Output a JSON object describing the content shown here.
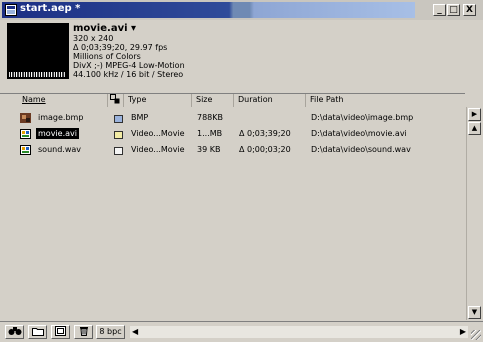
{
  "window": {
    "title": "start.aep *",
    "controls": {
      "minimize": "_",
      "maximize": "□",
      "close": "X"
    }
  },
  "preview": {
    "name": "movie.avi",
    "dropdown": "▾",
    "lines": [
      "320 x 240",
      "Δ 0;03;39;20, 29.97 fps",
      "Millions of Colors",
      "DivX ;-) MPEG-4 Low-Motion",
      "44.100 kHz / 16 bit / Stereo"
    ]
  },
  "columns": {
    "name": "Name",
    "label_icon": "label-icon",
    "type": "Type",
    "size": "Size",
    "duration": "Duration",
    "file_path": "File Path"
  },
  "items": [
    {
      "name": "image.bmp",
      "type": "BMP",
      "size": "788KB",
      "duration": "",
      "path": "D:\\data\\video\\image.bmp",
      "label_color": "#9ab2dc",
      "icon": "image-thumbnail-icon"
    },
    {
      "name": "movie.avi",
      "type": "Video...Movie",
      "size": "1...MB",
      "duration": "Δ 0;03;39;20",
      "path": "D:\\data\\video\\movie.avi",
      "label_color": "#f2eba4",
      "icon": "movie-footage-icon",
      "selected": true
    },
    {
      "name": "sound.wav",
      "type": "Video...Movie",
      "size": "39 KB",
      "duration": "Δ 0;00;03;20",
      "path": "D:\\data\\video\\sound.wav",
      "label_color": "#f4f4f4",
      "icon": "audio-footage-icon"
    }
  ],
  "bottombar": {
    "bpc": "8 bpc"
  }
}
